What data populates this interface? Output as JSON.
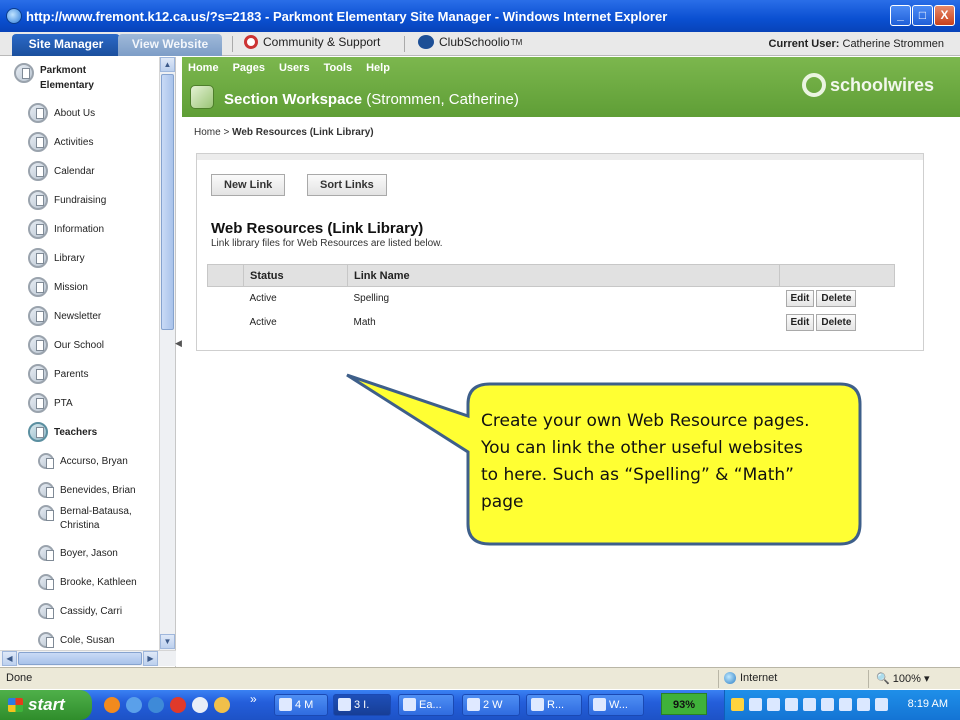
{
  "window": {
    "title": "http://www.fremont.k12.ca.us/?s=2183 - Parkmont Elementary Site Manager - Windows Internet Explorer",
    "buttons": {
      "minimize": "_",
      "maximize": "□",
      "close": "X"
    }
  },
  "tabbar": {
    "site_manager": "Site Manager",
    "view_website": "View Website",
    "community_support": "Community & Support",
    "clubschoolio": "ClubSchoolio",
    "clubschoolio_tm": "TM",
    "current_user_label": "Current User:",
    "current_user_name": "Catherine Strommen"
  },
  "sidebar": {
    "root_label_line1": "Parkmont",
    "root_label_line2": "Elementary",
    "items": [
      {
        "label": "About Us"
      },
      {
        "label": "Activities"
      },
      {
        "label": "Calendar"
      },
      {
        "label": "Fundraising"
      },
      {
        "label": "Information"
      },
      {
        "label": "Library"
      },
      {
        "label": "Mission"
      },
      {
        "label": "Newsletter"
      },
      {
        "label": "Our School"
      },
      {
        "label": "Parents"
      },
      {
        "label": "PTA"
      },
      {
        "label": "Teachers"
      }
    ],
    "teachers": [
      {
        "label": "Accurso, Bryan"
      },
      {
        "label": "Benevides, Brian"
      },
      {
        "label_line1": "Bernal-Batausa,",
        "label_line2": "Christina"
      },
      {
        "label": "Boyer, Jason"
      },
      {
        "label": "Brooke, Kathleen"
      },
      {
        "label": "Cassidy, Carri"
      },
      {
        "label": "Cole, Susan"
      }
    ]
  },
  "main": {
    "nav": [
      "Home",
      "Pages",
      "Users",
      "Tools",
      "Help"
    ],
    "workspace_title": "Section Workspace",
    "workspace_owner": "(Strommen, Catherine)",
    "brand": "schoolwires",
    "breadcrumb_home": "Home",
    "breadcrumb_sep": ">",
    "breadcrumb_current": "Web Resources (Link Library)",
    "buttons": {
      "new_link": "New Link",
      "sort_links": "Sort Links"
    },
    "heading": "Web Resources (Link Library)",
    "description": "Link library files for Web Resources are listed below.",
    "table": {
      "headers": [
        "",
        "Status",
        "Link Name",
        ""
      ],
      "rows": [
        {
          "status": "Active",
          "name": "Spelling",
          "edit": "Edit",
          "delete": "Delete"
        },
        {
          "status": "Active",
          "name": "Math",
          "edit": "Edit",
          "delete": "Delete"
        }
      ]
    }
  },
  "callout": {
    "line1": "Create your own Web Resource pages.",
    "line2": "You can link the other useful websites",
    "line3": "to here. Such as “Spelling” & “Math”",
    "line4": "page",
    "fill_color": "#ffff33",
    "border_color": "#3e5f8a"
  },
  "statusbar": {
    "done": "Done",
    "zone": "Internet",
    "zoom": "100%"
  },
  "taskbar": {
    "start": "start",
    "tasks": [
      {
        "label": "4 M"
      },
      {
        "label": "3 I."
      },
      {
        "label": "Ea..."
      },
      {
        "label": "2 W"
      },
      {
        "label": "R..."
      },
      {
        "label": "W..."
      }
    ],
    "battery_pct": "93%",
    "clock": "8:19 AM"
  }
}
